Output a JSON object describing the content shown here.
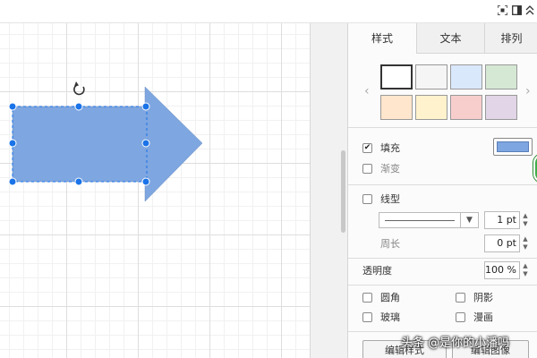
{
  "toolbar": {
    "icons": [
      "fullscreen-icon",
      "format-panel-icon",
      "collapse-icon"
    ]
  },
  "shape": {
    "kind": "arrow",
    "fill_color": "#7ea6e0",
    "stroke_color": "#6c8ebf",
    "handle_color": "#1a73e8"
  },
  "panel": {
    "tabs": [
      {
        "label": "样式",
        "active": true
      },
      {
        "label": "文本",
        "active": false
      },
      {
        "label": "排列",
        "active": false
      }
    ],
    "swatches": [
      "#ffffff",
      "#f5f5f5",
      "#dae8fc",
      "#d5e8d4",
      "#ffe6cc",
      "#fff2cc",
      "#f8cecc",
      "#e1d5e7"
    ],
    "fill": {
      "label": "填充",
      "checked": true,
      "color": "#7ea6e0"
    },
    "gradient": {
      "label": "渐变",
      "checked": false
    },
    "line": {
      "label": "线型",
      "checked": false,
      "width": "1 pt"
    },
    "perimeter": {
      "label": "周长",
      "value": "0 pt"
    },
    "opacity": {
      "label": "透明度",
      "value": "100 %"
    },
    "options": {
      "rounded": "圆角",
      "shadow": "阴影",
      "glass": "玻璃",
      "sketch": "漫画"
    },
    "buttons": {
      "edit_style": "编辑样式",
      "edit_image": "编辑图像"
    }
  },
  "watermark": "头条 @是你的小潘吗"
}
